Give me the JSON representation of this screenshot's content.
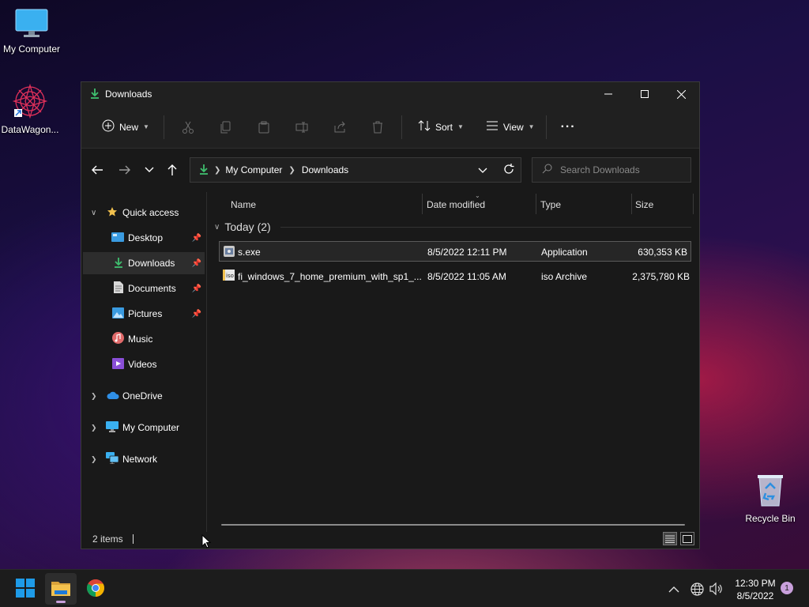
{
  "desktop": {
    "icons": [
      {
        "label": "My Computer",
        "icon": "monitor-icon"
      },
      {
        "label": "DataWagon...",
        "icon": "datawagon-app-icon"
      },
      {
        "label": "Recycle Bin",
        "icon": "recycle-bin-icon"
      }
    ]
  },
  "window": {
    "title": "Downloads",
    "toolbar": {
      "new_label": "New",
      "sort_label": "Sort",
      "view_label": "View",
      "more_label": "···"
    },
    "address": {
      "segments": [
        "My Computer",
        "Downloads"
      ]
    },
    "search": {
      "placeholder": "Search Downloads"
    },
    "sidebar": {
      "quick_access": "Quick access",
      "items": [
        {
          "label": "Desktop",
          "pinned": true
        },
        {
          "label": "Downloads",
          "pinned": true,
          "selected": true
        },
        {
          "label": "Documents",
          "pinned": true
        },
        {
          "label": "Pictures",
          "pinned": true
        },
        {
          "label": "Music"
        },
        {
          "label": "Videos"
        }
      ],
      "roots": [
        "OneDrive",
        "My Computer",
        "Network"
      ]
    },
    "columns": [
      "Name",
      "Date modified",
      "Type",
      "Size"
    ],
    "group": {
      "label": "Today (2)"
    },
    "files": [
      {
        "name": "s.exe",
        "date": "8/5/2022 12:11 PM",
        "type": "Application",
        "size": "630,353 KB",
        "icon": "exe-file-icon"
      },
      {
        "name": "fi_windows_7_home_premium_with_sp1_...",
        "date": "8/5/2022 11:05 AM",
        "type": "iso Archive",
        "size": "2,375,780 KB",
        "icon": "iso-file-icon"
      }
    ],
    "status": {
      "items_count": "2 items"
    }
  },
  "taskbar": {
    "clock_time": "12:30 PM",
    "clock_date": "8/5/2022",
    "notification_count": "1"
  },
  "colors": {
    "accent_download": "#3fbf6f",
    "folder_yellow": "#f2c14e",
    "windows_blue": "#1e9be8"
  }
}
